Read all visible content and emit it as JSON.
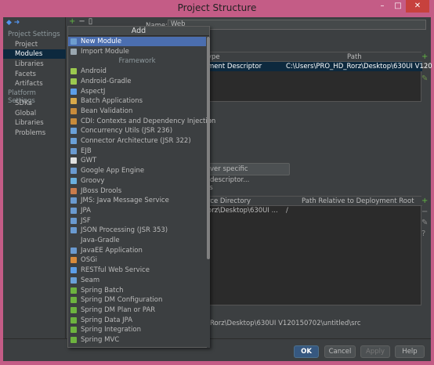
{
  "window": {
    "title": "Project Structure",
    "min_glyph": "–",
    "max_glyph": "□",
    "close_glyph": "✕"
  },
  "sidebar": {
    "nav_glyphs": "◆ ➜",
    "project_settings": "Project Settings",
    "items_ps": [
      "Project",
      "Modules",
      "Libraries",
      "Facets",
      "Artifacts"
    ],
    "platform_settings": "Platform Settings",
    "items_plat": [
      "SDKs",
      "Global Libraries"
    ],
    "problems": "Problems",
    "selected": "Modules"
  },
  "toolbar": {
    "add_glyph": "+",
    "remove_glyph": "−",
    "copy_glyph": "▯"
  },
  "module_name": {
    "label": "Name:",
    "value": "Web"
  },
  "descriptors_table": {
    "headers": [
      "ype",
      "Path"
    ],
    "row": [
      "ment Descriptor",
      "C:\\Users\\PRO_HD_Rorz\\Desktop\\630UI V120"
    ]
  },
  "add_descriptor_button": "ver specific descriptor...",
  "resource_section_label": "es",
  "resources_table": {
    "headers": [
      "rce Directory",
      "Path Relative to Deployment Root"
    ],
    "row": [
      "orz\\Desktop\\630UI ...",
      "/"
    ]
  },
  "source_root_path": "Rorz\\Desktop\\630UI V120150702\\untitled\\src",
  "buttons": {
    "ok": "OK",
    "cancel": "Cancel",
    "apply": "Apply",
    "help": "Help"
  },
  "popup": {
    "title": "Add",
    "top_items": [
      {
        "label": "New Module",
        "icon": "module-icon",
        "color": "#6e9ecf"
      },
      {
        "label": "Import Module",
        "icon": "import-icon",
        "color": "#9aa7b0"
      }
    ],
    "framework_label": "Framework",
    "framework_items": [
      {
        "label": "Android",
        "icon": "android-icon",
        "color": "#9bc94f"
      },
      {
        "label": "Android-Gradle",
        "icon": "android-icon",
        "color": "#9bc94f"
      },
      {
        "label": "AspectJ",
        "icon": "aspectj-icon",
        "color": "#5c9ee8"
      },
      {
        "label": "Batch Applications",
        "icon": "batch-icon",
        "color": "#d8a94a"
      },
      {
        "label": "Bean Validation",
        "icon": "bean-icon",
        "color": "#c88b3a"
      },
      {
        "label": "CDI: Contexts and Dependency Injection",
        "icon": "cdi-icon",
        "color": "#c88b3a"
      },
      {
        "label": "Concurrency Utils (JSR 236)",
        "icon": "concurrency-icon",
        "color": "#6aa0d8"
      },
      {
        "label": "Connector Architecture (JSR 322)",
        "icon": "connector-icon",
        "color": "#6aa0d8"
      },
      {
        "label": "EJB",
        "icon": "ejb-icon",
        "color": "#6a9ad0"
      },
      {
        "label": "GWT",
        "icon": "gwt-icon",
        "color": "#e0e0e0"
      },
      {
        "label": "Google App Engine",
        "icon": "gae-icon",
        "color": "#6a9ad0"
      },
      {
        "label": "Groovy",
        "icon": "groovy-icon",
        "color": "#6ab0de"
      },
      {
        "label": "JBoss Drools",
        "icon": "drools-icon",
        "color": "#c97b4b"
      },
      {
        "label": "JMS: Java Message Service",
        "icon": "jms-icon",
        "color": "#6a9ad0"
      },
      {
        "label": "JPA",
        "icon": "jpa-icon",
        "color": "#6a9ad0"
      },
      {
        "label": "JSF",
        "icon": "jsf-icon",
        "color": "#6a9ad0"
      },
      {
        "label": "JSON Processing (JSR 353)",
        "icon": "json-icon",
        "color": "#6a9ad0"
      },
      {
        "label": "Java-Gradle",
        "icon": "",
        "color": ""
      },
      {
        "label": "JavaEE Application",
        "icon": "javaee-icon",
        "color": "#6a9ad0"
      },
      {
        "label": "OSGi",
        "icon": "osgi-icon",
        "color": "#d88a3a"
      },
      {
        "label": "RESTful Web Service",
        "icon": "rest-icon",
        "color": "#5c9ee8"
      },
      {
        "label": "Seam",
        "icon": "seam-icon",
        "color": "#6aa0d8"
      },
      {
        "label": "Spring Batch",
        "icon": "spring-icon",
        "color": "#6db33f"
      },
      {
        "label": "Spring DM Configuration",
        "icon": "spring-icon",
        "color": "#6db33f"
      },
      {
        "label": "Spring DM Plan or PAR",
        "icon": "spring-icon",
        "color": "#6db33f"
      },
      {
        "label": "Spring Data JPA",
        "icon": "spring-icon",
        "color": "#6db33f"
      },
      {
        "label": "Spring Integration",
        "icon": "spring-icon",
        "color": "#6db33f"
      },
      {
        "label": "Spring MVC",
        "icon": "spring-icon",
        "color": "#6db33f"
      }
    ]
  }
}
